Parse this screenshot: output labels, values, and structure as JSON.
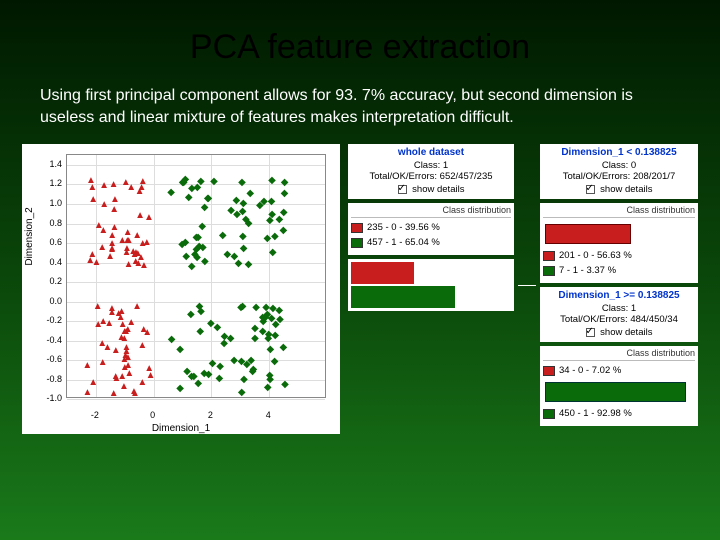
{
  "title": "PCA feature extraction",
  "body": "Using first principal component allows for 93. 7% accuracy, but second dimension is useless and linear mixture of features makes interpretation difficult.",
  "chart_data": {
    "type": "scatter",
    "title": "",
    "xlabel": "Dimension_1",
    "ylabel": "Dimension_2",
    "xlim": [
      -3,
      6
    ],
    "ylim": [
      -1.0,
      1.5
    ],
    "xticks": [
      -2,
      0,
      2,
      4
    ],
    "yticks": [
      -1.0,
      -0.8,
      -0.6,
      -0.4,
      -0.2,
      0.0,
      0.2,
      0.4,
      0.6,
      0.8,
      1.0,
      1.2,
      1.4
    ],
    "series": [
      {
        "name": "Class 0",
        "color": "#c81e1e",
        "marker": "triangle",
        "points_approx": "two red clusters: (x≈-2..0, y≈0.3..1.3) and (x≈-2..0, y≈-0.9..-0.1)"
      },
      {
        "name": "Class 1",
        "color": "#0a6b0a",
        "marker": "diamond",
        "points_approx": "two green clusters: (x≈0.5..5, y≈0.3..1.3) and (x≈0.5..5, y≈-0.9..-0.1)"
      }
    ]
  },
  "tree": {
    "root": {
      "header": "whole dataset",
      "class_line": "Class: 1",
      "stats_line": "Total/OK/Errors: 652/457/235",
      "show_details": "show details",
      "dist_title": "Class distribution",
      "rows": [
        {
          "cls": "red",
          "label": "235 - 0 - 39.56 %",
          "bar_width_pct": 39.56
        },
        {
          "cls": "green",
          "label": "457 - 1 - 65.04 %",
          "bar_width_pct": 65.04
        }
      ]
    },
    "left_child": {
      "header": "Dimension_1 < 0.138825",
      "class_line": "Class: 0",
      "stats_line": "Total/OK/Errors: 208/201/7",
      "show_details": "show details",
      "dist_title": "Class distribution",
      "rows": [
        {
          "cls": "red",
          "label": "201 - 0 - 56.63 %",
          "bar_width_pct": 56.63
        },
        {
          "cls": "green",
          "label": "7 - 1 - 3.37 %",
          "bar_width_pct": 3.37
        }
      ]
    },
    "right_child": {
      "header": "Dimension_1 >= 0.138825",
      "class_line": "Class: 1",
      "stats_line": "Total/OK/Errors: 484/450/34",
      "show_details": "show details",
      "dist_title": "Class distribution",
      "rows": [
        {
          "cls": "red",
          "label": "34 - 0 - 7.02 %",
          "bar_width_pct": 7.02
        },
        {
          "cls": "green",
          "label": "450 - 1 - 92.98 %",
          "bar_width_pct": 92.98
        }
      ]
    }
  }
}
